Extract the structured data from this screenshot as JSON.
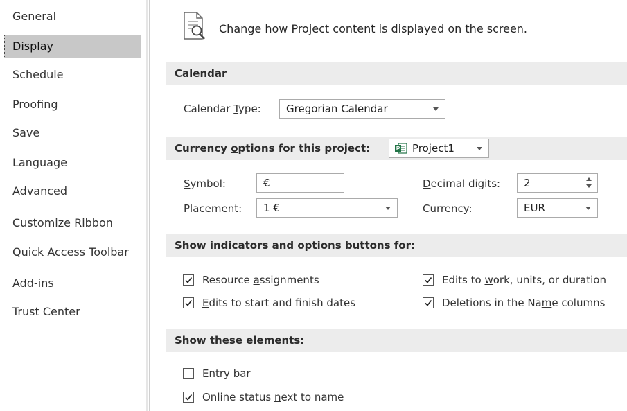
{
  "sidebar": {
    "items": [
      {
        "label": "General",
        "selected": false
      },
      {
        "label": "Display",
        "selected": true
      },
      {
        "label": "Schedule",
        "selected": false
      },
      {
        "label": "Proofing",
        "selected": false
      },
      {
        "label": "Save",
        "selected": false
      },
      {
        "label": "Language",
        "selected": false
      },
      {
        "label": "Advanced",
        "selected": false
      },
      {
        "label": "Customize Ribbon",
        "selected": false
      },
      {
        "label": "Quick Access Toolbar",
        "selected": false
      },
      {
        "label": "Add-ins",
        "selected": false
      },
      {
        "label": "Trust Center",
        "selected": false
      }
    ]
  },
  "intro": {
    "text": "Change how Project content is displayed on the screen.",
    "icon": "document-magnifier-icon"
  },
  "calendar": {
    "header": "Calendar",
    "type_label_pre": "Calendar ",
    "type_label_u": "T",
    "type_label_post": "ype:",
    "type_value": "Gregorian Calendar"
  },
  "currency": {
    "header_pre": "Currency ",
    "header_u": "o",
    "header_post": "ptions for this project:",
    "project_value": "Project1",
    "symbol_label_u": "S",
    "symbol_label_post": "ymbol:",
    "symbol_value": "€",
    "placement_label_u": "P",
    "placement_label_post": "lacement:",
    "placement_value": "1 €",
    "decimal_label_u": "D",
    "decimal_label_post": "ecimal digits:",
    "decimal_value": "2",
    "currency_label_u": "C",
    "currency_label_post": "urrency:",
    "currency_value": "EUR"
  },
  "indicators": {
    "header": "Show indicators and options buttons for:",
    "resource": {
      "pre": "Resource ",
      "u": "a",
      "post": "ssignments",
      "checked": true
    },
    "edits_start": {
      "pre": "",
      "u": "E",
      "post": "dits to start and finish dates",
      "checked": true
    },
    "edits_work": {
      "pre": "Edits to ",
      "u": "w",
      "post": "ork, units, or duration",
      "checked": true
    },
    "deletions": {
      "pre": "Deletions in the Na",
      "u": "m",
      "post": "e columns",
      "checked": true
    }
  },
  "elements": {
    "header": "Show these elements:",
    "entry_bar": {
      "pre": "Entry ",
      "u": "b",
      "post": "ar",
      "checked": false
    },
    "online_status": {
      "pre": "Online status ",
      "u": "n",
      "post": "ext to name",
      "checked": true
    }
  },
  "colors": {
    "selected_bg": "#c8c8c8",
    "section_bg": "#ececec",
    "project_icon_green": "#217346"
  }
}
